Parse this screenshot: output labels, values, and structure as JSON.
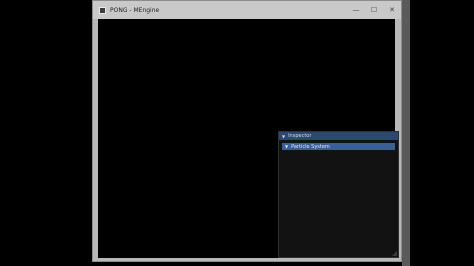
{
  "window": {
    "title": "PONG - MEngine",
    "controls": {
      "minimize": "—",
      "maximize": "☐",
      "close": "✕"
    }
  },
  "inspector": {
    "title": "Inspector",
    "sections": [
      {
        "label": "Particle System"
      }
    ]
  }
}
